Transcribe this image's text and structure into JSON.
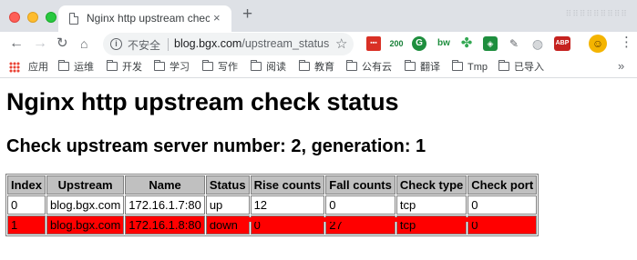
{
  "browser": {
    "tab_title": "Nginx http upstream check status",
    "tab_close": "×",
    "new_tab": "+",
    "omnibox": {
      "security_label": "不安全",
      "host": "blog.bgx.com",
      "path": "/upstream_status"
    },
    "extensions": {
      "counter_badge": "200",
      "bw_label": "bw",
      "abp_label": "ABP"
    },
    "bookmarks": [
      {
        "label": "应用"
      },
      {
        "label": "运维"
      },
      {
        "label": "开发"
      },
      {
        "label": "学习"
      },
      {
        "label": "写作"
      },
      {
        "label": "阅读"
      },
      {
        "label": "教育"
      },
      {
        "label": "公有云"
      },
      {
        "label": "翻译"
      },
      {
        "label": "Tmp"
      },
      {
        "label": "已导入"
      }
    ],
    "bookmarks_more": "»"
  },
  "page": {
    "title": "Nginx http upstream check status",
    "subtitle": "Check upstream server number: 2, generation: 1",
    "table": {
      "headers": [
        "Index",
        "Upstream",
        "Name",
        "Status",
        "Rise counts",
        "Fall counts",
        "Check type",
        "Check port"
      ],
      "rows": [
        {
          "index": "0",
          "upstream": "blog.bgx.com",
          "name": "172.16.1.7:80",
          "status": "up",
          "rise": "12",
          "fall": "0",
          "type": "tcp",
          "port": "0"
        },
        {
          "index": "1",
          "upstream": "blog.bgx.com",
          "name": "172.16.1.8:80",
          "status": "down",
          "rise": "0",
          "fall": "27",
          "type": "tcp",
          "port": "0"
        }
      ]
    }
  },
  "colors": {
    "down_row": "#ff0000",
    "header_bg": "#c0c0c0",
    "border": "#808080"
  }
}
